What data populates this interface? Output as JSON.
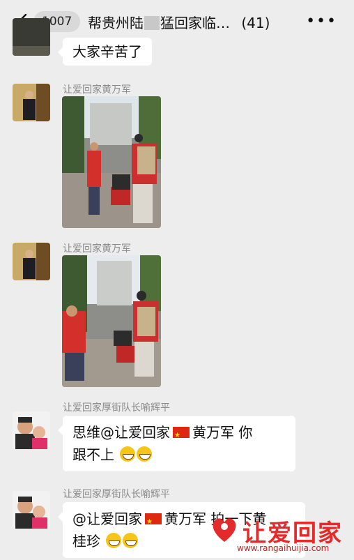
{
  "header": {
    "unread_count": "1007",
    "title_part1": "帮贵州陆",
    "title_part2": "猛回家临…",
    "member_count": "(41)"
  },
  "messages": [
    {
      "type": "text",
      "text": "大家辛苦了"
    },
    {
      "type": "image",
      "sender": "让爱回家黄万军"
    },
    {
      "type": "image",
      "sender": "让爱回家黄万军"
    },
    {
      "type": "text",
      "sender": "让爱回家厚街队长喻辉平",
      "line1_a": "思维",
      "line1_b": "@让爱回家",
      "line1_c": "黄万军 你",
      "line2": "跟不上"
    },
    {
      "type": "text",
      "sender": "让爱回家厚街队长喻辉平",
      "line1_a": "@让爱回家",
      "line1_b": "黄万军 拍一下黄",
      "line2": "桂珍"
    }
  ],
  "watermark": {
    "brand": "让爱回家",
    "url": "www.rangaihuijia.com",
    "brand_color": "#e32b2b"
  },
  "icons": [
    "back-chevron-icon",
    "more-icon",
    "grin-emoji-icon",
    "china-flag-icon"
  ]
}
